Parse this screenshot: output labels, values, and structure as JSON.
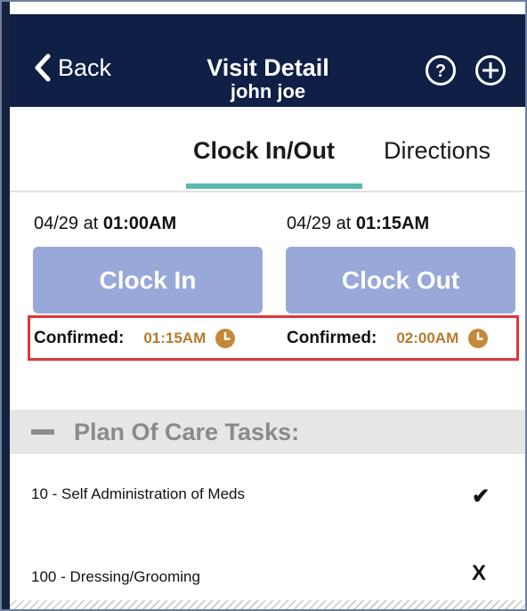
{
  "header": {
    "back_label": "Back",
    "title": "Visit Detail",
    "subtitle": "john joe",
    "help_icon": "question-circle-icon",
    "add_icon": "plus-circle-icon"
  },
  "tabs": [
    {
      "label": "Clock In/Out",
      "active": true
    },
    {
      "label": "Directions",
      "active": false
    }
  ],
  "clock_in": {
    "date_prefix": "04/29 at ",
    "time": "01:00AM",
    "button_label": "Clock In",
    "confirmed_label": "Confirmed:",
    "confirmed_time": "01:15AM"
  },
  "clock_out": {
    "date_prefix": "04/29 at ",
    "time": "01:15AM",
    "button_label": "Clock Out",
    "confirmed_label": "Confirmed:",
    "confirmed_time": "02:00AM"
  },
  "plan": {
    "title": "Plan Of Care Tasks:",
    "tasks": [
      {
        "label": "10 - Self Administration of Meds",
        "status_mark": "✔",
        "status": "done"
      },
      {
        "label": "100 - Dressing/Grooming",
        "status_mark": "X",
        "status": "not-done"
      }
    ]
  },
  "colors": {
    "header_bg": "#0f1f45",
    "button_bg": "#97a8d9",
    "tab_underline": "#5ab7b0",
    "confirm_time": "#b87b2d",
    "highlight_box": "#e0373b"
  }
}
